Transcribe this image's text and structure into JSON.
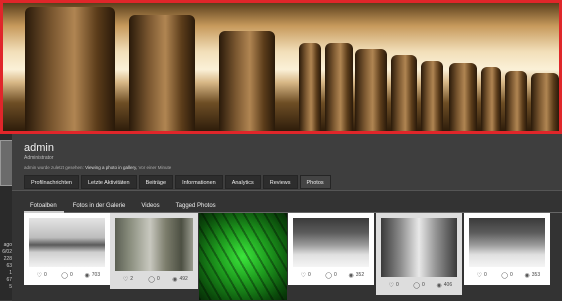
{
  "sidebar": {
    "numbers": [
      "ago",
      "6/02",
      "228",
      "63",
      "1",
      "67",
      "5"
    ]
  },
  "profile": {
    "name": "admin",
    "role": "Administrator",
    "activity_prefix": "admin wurde zuletzt gesehen:",
    "activity_action": "Viewing a photo in gallery,",
    "activity_time": "Vor einer Minute"
  },
  "tabs": [
    {
      "label": "Profilnachrichten"
    },
    {
      "label": "Letzte Aktivitäten"
    },
    {
      "label": "Beiträge"
    },
    {
      "label": "Informationen"
    },
    {
      "label": "Analytics"
    },
    {
      "label": "Reviews"
    },
    {
      "label": "Photos"
    }
  ],
  "subtabs": [
    {
      "label": "Fotoalben"
    },
    {
      "label": "Fotos in der Galerie"
    },
    {
      "label": "Videos"
    },
    {
      "label": "Tagged Photos"
    }
  ],
  "icons": {
    "heart": "heart-icon",
    "comment": "comment-icon",
    "views": "eye-icon"
  },
  "photos": [
    {
      "likes": "0",
      "comments": "0",
      "views": "703"
    },
    {
      "likes": "2",
      "comments": "0",
      "views": "492"
    },
    {
      "likes": "",
      "comments": "",
      "views": ""
    },
    {
      "likes": "0",
      "comments": "0",
      "views": "352"
    },
    {
      "likes": "0",
      "comments": "0",
      "views": "406"
    },
    {
      "likes": "0",
      "comments": "0",
      "views": "353"
    }
  ]
}
